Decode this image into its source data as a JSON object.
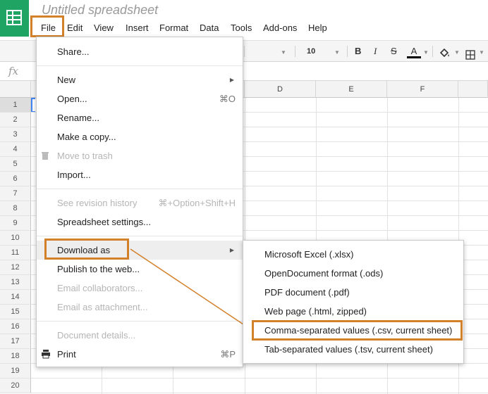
{
  "app": {
    "title": "Untitled spreadsheet"
  },
  "menubar": [
    "File",
    "Edit",
    "View",
    "Insert",
    "Format",
    "Data",
    "Tools",
    "Add-ons",
    "Help"
  ],
  "toolbar": {
    "font_size": "10",
    "bold": "B",
    "italic": "I",
    "strike": "S",
    "text_color": "A"
  },
  "formula_bar": {
    "fx_label": "fx"
  },
  "grid": {
    "columns": [
      "D",
      "E",
      "F"
    ],
    "rows": [
      "1",
      "2",
      "3",
      "4",
      "5",
      "6",
      "7",
      "8",
      "9",
      "10",
      "11",
      "12",
      "13",
      "14",
      "15",
      "16",
      "17",
      "18",
      "19",
      "20"
    ]
  },
  "file_menu": {
    "share": "Share...",
    "new": "New",
    "open": "Open...",
    "open_shortcut": "⌘O",
    "rename": "Rename...",
    "copy": "Make a copy...",
    "trash": "Move to trash",
    "import": "Import...",
    "revision": "See revision history",
    "revision_shortcut": "⌘+Option+Shift+H",
    "settings": "Spreadsheet settings...",
    "download": "Download as",
    "publish": "Publish to the web...",
    "email_collab": "Email collaborators...",
    "email_attach": "Email as attachment...",
    "details": "Document details...",
    "print": "Print",
    "print_shortcut": "⌘P"
  },
  "download_submenu": [
    "Microsoft Excel (.xlsx)",
    "OpenDocument format (.ods)",
    "PDF document (.pdf)",
    "Web page (.html, zipped)",
    "Comma-separated values (.csv, current sheet)",
    "Tab-separated values (.tsv, current sheet)"
  ],
  "colors": {
    "accent": "#1fa463",
    "annotation": "#d2802a",
    "selection": "#4285f4"
  }
}
